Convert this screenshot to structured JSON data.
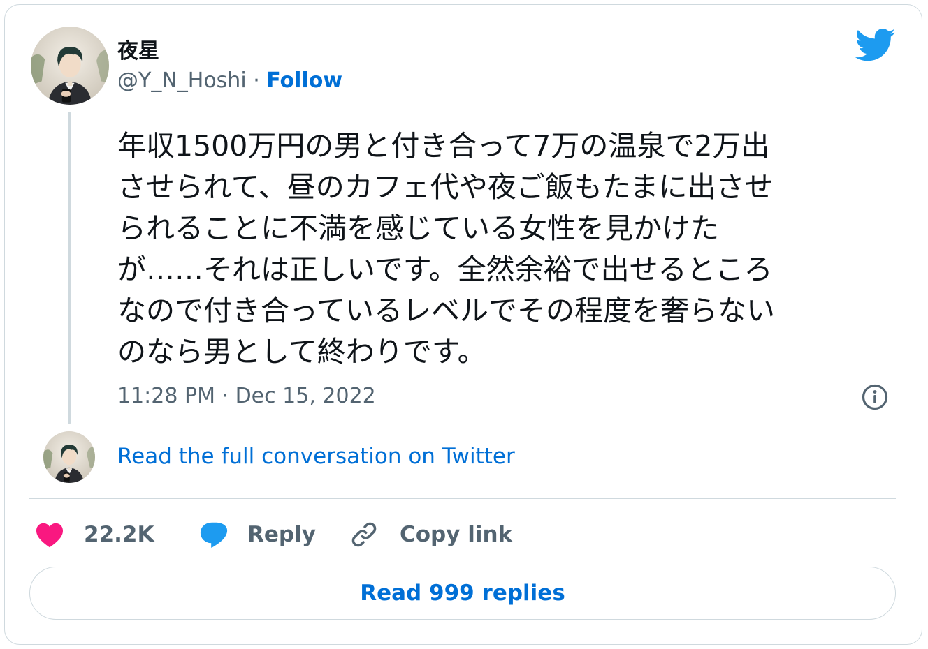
{
  "author": {
    "display_name": "夜星",
    "handle": "@Y_N_Hoshi",
    "separator": " · ",
    "follow_label": "Follow",
    "avatar_icon": "avatar-illustration"
  },
  "brand": {
    "logo_icon": "twitter-bird-icon",
    "color": "#1d9bf0"
  },
  "tweet": {
    "text": "年収1500万円の男と付き合って7万の温泉で2万出\nさせられて、昼のカフェ代や夜ご飯もたまに出させ\nられることに不満を感じている女性を見かけた\nが……それは正しいです。全然余裕で出せるところ\nなので付き合っているレベルでその程度を奢らない\nのなら男として終わりです。",
    "timestamp": "11:28 PM · Dec 15, 2022",
    "info_icon": "info-icon"
  },
  "conversation": {
    "link_label": "Read the full conversation on Twitter"
  },
  "actions": {
    "like_count": "22.2K",
    "like_icon": "heart-icon",
    "like_color": "#f91880",
    "reply_label": "Reply",
    "reply_icon": "speech-bubble-icon",
    "reply_color": "#1d9bf0",
    "copy_label": "Copy link",
    "copy_icon": "link-icon"
  },
  "replies": {
    "button_label": "Read 999 replies"
  },
  "colors": {
    "text_primary": "#0f1419",
    "text_secondary": "#536471",
    "link": "#006fd6",
    "border": "#cfd9de"
  }
}
